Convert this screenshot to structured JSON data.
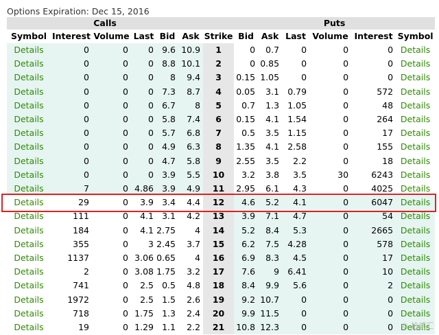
{
  "caption": "Options Expiration: Dec 15, 2016",
  "group_headers": {
    "calls": "Calls",
    "puts": "Puts"
  },
  "columns": [
    "Symbol",
    "Interest",
    "Volume",
    "Last",
    "Bid",
    "Ask",
    "Strike",
    "Bid",
    "Ask",
    "Last",
    "Volume",
    "Interest",
    "Symbol"
  ],
  "link_label": "Details",
  "highlighted_strike": "12",
  "rows": [
    {
      "call": [
        "0",
        "0",
        "0",
        "9.6",
        "10.9"
      ],
      "strike": "1",
      "put": [
        "0",
        "0.7",
        "0",
        "0",
        "0"
      ],
      "itm": "calls"
    },
    {
      "call": [
        "0",
        "0",
        "0",
        "8.8",
        "10.1"
      ],
      "strike": "2",
      "put": [
        "0",
        "0.85",
        "0",
        "0",
        "0"
      ],
      "itm": "calls"
    },
    {
      "call": [
        "0",
        "0",
        "0",
        "8",
        "9.4"
      ],
      "strike": "3",
      "put": [
        "0.15",
        "1.05",
        "0",
        "0",
        "0"
      ],
      "itm": "calls"
    },
    {
      "call": [
        "0",
        "0",
        "0",
        "7.3",
        "8.7"
      ],
      "strike": "4",
      "put": [
        "0.05",
        "3.1",
        "0.79",
        "0",
        "572"
      ],
      "itm": "calls"
    },
    {
      "call": [
        "0",
        "0",
        "0",
        "6.7",
        "8"
      ],
      "strike": "5",
      "put": [
        "0.7",
        "1.3",
        "1.05",
        "0",
        "48"
      ],
      "itm": "calls"
    },
    {
      "call": [
        "0",
        "0",
        "0",
        "5.8",
        "7.4"
      ],
      "strike": "6",
      "put": [
        "0.15",
        "4.1",
        "1.54",
        "0",
        "264"
      ],
      "itm": "calls"
    },
    {
      "call": [
        "0",
        "0",
        "0",
        "5.7",
        "6.8"
      ],
      "strike": "7",
      "put": [
        "0.5",
        "3.5",
        "1.15",
        "0",
        "17"
      ],
      "itm": "calls"
    },
    {
      "call": [
        "0",
        "0",
        "0",
        "4.9",
        "6.3"
      ],
      "strike": "8",
      "put": [
        "1.35",
        "4.1",
        "2.58",
        "0",
        "155"
      ],
      "itm": "calls"
    },
    {
      "call": [
        "0",
        "0",
        "0",
        "4.7",
        "5.8"
      ],
      "strike": "9",
      "put": [
        "2.55",
        "3.5",
        "2.2",
        "0",
        "18"
      ],
      "itm": "calls"
    },
    {
      "call": [
        "0",
        "0",
        "0",
        "3.9",
        "5.5"
      ],
      "strike": "10",
      "put": [
        "3.2",
        "3.8",
        "3.5",
        "30",
        "6243"
      ],
      "itm": "calls"
    },
    {
      "call": [
        "7",
        "0",
        "4.86",
        "3.9",
        "4.9"
      ],
      "strike": "11",
      "put": [
        "2.95",
        "6.1",
        "4.3",
        "0",
        "4025"
      ],
      "itm": "calls"
    },
    {
      "call": [
        "29",
        "0",
        "3.9",
        "3.4",
        "4.4"
      ],
      "strike": "12",
      "put": [
        "4.6",
        "5.2",
        "4.1",
        "0",
        "6047"
      ],
      "itm": "puts"
    },
    {
      "call": [
        "111",
        "0",
        "4.1",
        "3.1",
        "4.2"
      ],
      "strike": "13",
      "put": [
        "3.9",
        "7.1",
        "4.7",
        "0",
        "54"
      ],
      "itm": "puts"
    },
    {
      "call": [
        "184",
        "0",
        "4.1",
        "2.75",
        "4"
      ],
      "strike": "14",
      "put": [
        "5.2",
        "8.4",
        "5.3",
        "0",
        "2665"
      ],
      "itm": "puts"
    },
    {
      "call": [
        "355",
        "0",
        "3",
        "2.45",
        "3.7"
      ],
      "strike": "15",
      "put": [
        "6.2",
        "7.5",
        "4.28",
        "0",
        "578"
      ],
      "itm": "puts"
    },
    {
      "call": [
        "1137",
        "0",
        "3.06",
        "0.65",
        "4"
      ],
      "strike": "16",
      "put": [
        "6.9",
        "8.3",
        "4.5",
        "0",
        "17"
      ],
      "itm": "puts"
    },
    {
      "call": [
        "2",
        "0",
        "3.08",
        "1.75",
        "3.2"
      ],
      "strike": "17",
      "put": [
        "7.6",
        "9",
        "6.41",
        "0",
        "10"
      ],
      "itm": "puts"
    },
    {
      "call": [
        "741",
        "0",
        "2.5",
        "0.5",
        "4.8"
      ],
      "strike": "18",
      "put": [
        "8.4",
        "9.9",
        "5.6",
        "0",
        "2"
      ],
      "itm": "puts"
    },
    {
      "call": [
        "1972",
        "0",
        "2.5",
        "1.5",
        "2.6"
      ],
      "strike": "19",
      "put": [
        "9.2",
        "10.7",
        "0",
        "0",
        "0"
      ],
      "itm": "puts"
    },
    {
      "call": [
        "718",
        "0",
        "1.75",
        "1.3",
        "2.4"
      ],
      "strike": "20",
      "put": [
        "9.9",
        "11.5",
        "0",
        "0",
        "0"
      ],
      "itm": "puts"
    },
    {
      "call": [
        "19",
        "0",
        "1.29",
        "1.1",
        "2.2"
      ],
      "strike": "21",
      "put": [
        "10.8",
        "12.3",
        "0",
        "0",
        "0"
      ],
      "itm": "puts"
    }
  ],
  "watermark": "© 拾贰汇",
  "colors": {
    "link": "#2e8b00",
    "in_the_money_bg": "#e6f5f2",
    "strike_bg": "#e7e7e7",
    "highlight": "#e02020"
  }
}
